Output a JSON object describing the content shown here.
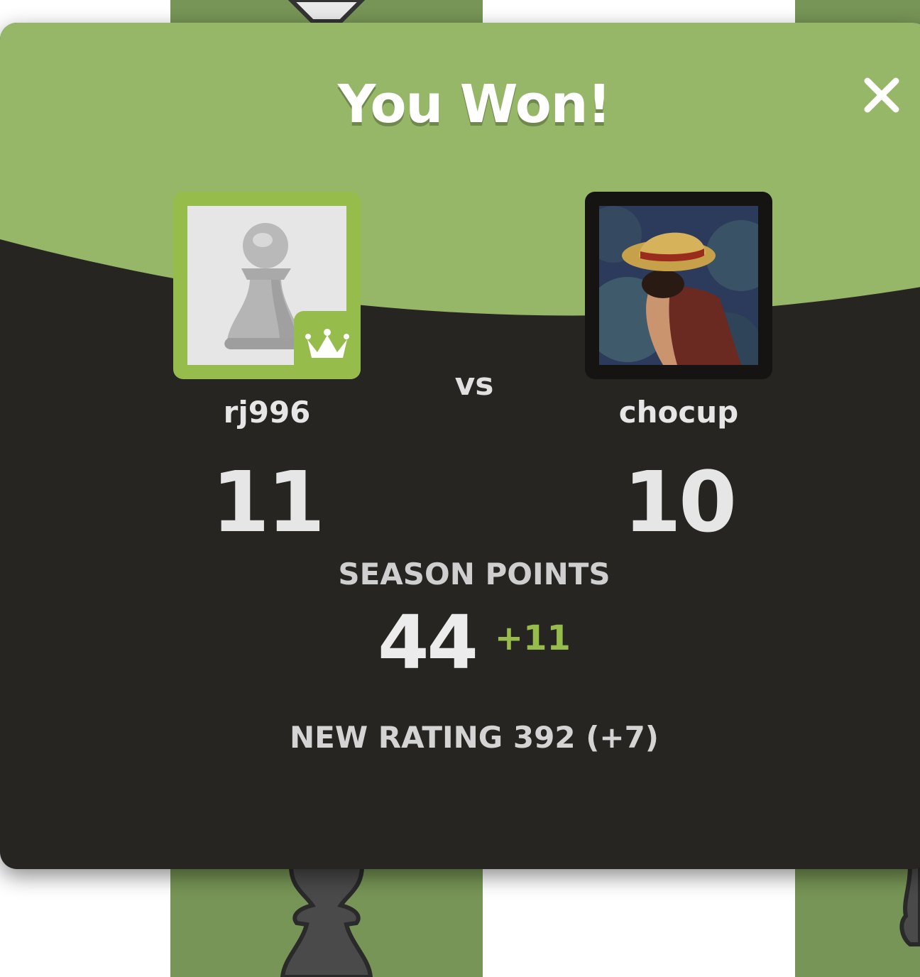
{
  "modal": {
    "title": "You Won!",
    "close_icon": "close-icon",
    "vs_label": "vs"
  },
  "players": {
    "me": {
      "username": "rj996",
      "score": "11",
      "avatar_icon": "pawn-icon",
      "badge_icon": "crown-icon"
    },
    "opponent": {
      "username": "chocup",
      "score": "10",
      "avatar": "profile-picture"
    }
  },
  "season": {
    "label": "SEASON POINTS",
    "points": "44",
    "delta": "+11"
  },
  "rating": {
    "text": "NEW RATING 392 (+7)"
  },
  "colors": {
    "accent_green": "#96bc4b",
    "modal_dark": "#262522",
    "board_green": "#779556",
    "board_light": "#ffffff"
  }
}
